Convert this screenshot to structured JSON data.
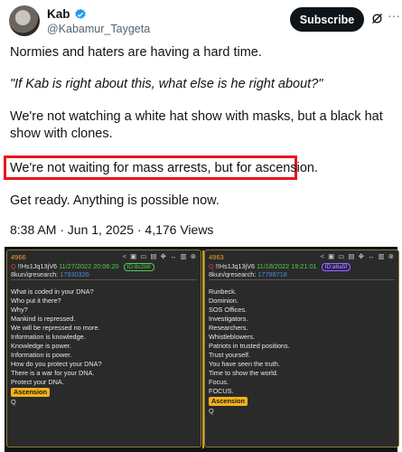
{
  "header": {
    "display_name": "Kab",
    "handle": "@Kabamur_Taygeta",
    "subscribe_label": "Subscribe",
    "more_label": "···"
  },
  "tweet": {
    "line1": "Normies and haters are having a hard time.",
    "line2": "\"If Kab is right about this, what else is he right about?\"",
    "line3": "We're not watching a white hat show with masks, but a black hat show with clones.",
    "line4": "We're not waiting for mass arrests, but for ascension.",
    "line5": "Get ready. Anything is possible now.",
    "meta": "8:38 AM · Jun 1, 2025 · 4,176 Views"
  },
  "colors": {
    "highlight": "#e8161b",
    "accent_gold": "#f2b21b",
    "date_green": "#4ccf4c"
  },
  "drops": [
    {
      "number": "4966",
      "q": "Q",
      "trip": "!!Hs1Jq13jV6",
      "date": "11/27/2022 20:06:20",
      "id_badge": "ID:8c2b6",
      "board": "8kun/qresearch:",
      "board_post": "17930326",
      "lines": [
        "What is coded in your DNA?",
        "Who put it there?",
        "Why?",
        "Mankind is repressed.",
        "We will be repressed no more.",
        "Information is knowledge.",
        "Knowledge is power.",
        "Information is power.",
        "How do you protect your DNA?",
        "There is a war for your DNA.",
        "Protect your DNA."
      ],
      "tag": "Ascension",
      "signature": "Q"
    },
    {
      "number": "4963",
      "q": "Q",
      "trip": "!!Hs1Jq13jV6",
      "date": "11/18/2022 19:21:01",
      "id_badge": "ID:a6a5f",
      "board": "8kun/qresearch:",
      "board_post": "17798718",
      "lines": [
        "Runbeck.",
        "Dominion.",
        "SOS Offices.",
        "Investigators.",
        "Researchers.",
        "Whistleblowers.",
        "Patriots in trusted positions.",
        "Trust yourself.",
        "You have seen the truth.",
        "Time to show the world.",
        "Focus.",
        "FOCUS."
      ],
      "tag": "Ascension",
      "signature": "Q"
    }
  ]
}
